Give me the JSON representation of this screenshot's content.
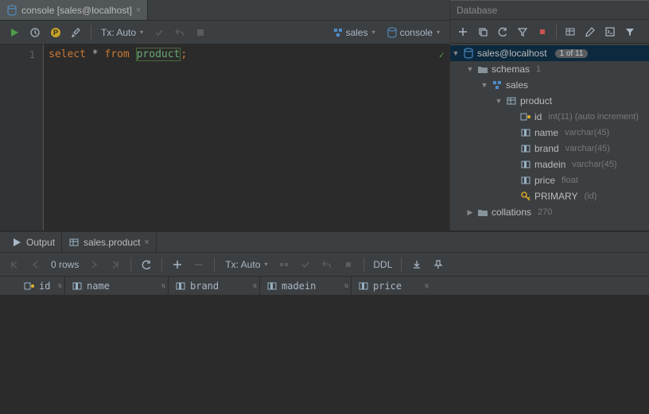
{
  "editor": {
    "tab_label": "console [sales@localhost]",
    "line_number": "1",
    "sql": {
      "k1": "select",
      "star": " * ",
      "k2": "from",
      "sp": " ",
      "tbl": "product",
      "semi": ";"
    },
    "tx_label": "Tx: Auto",
    "context_db": "sales",
    "context_console": "console"
  },
  "db": {
    "panel_title": "Database",
    "datasource": "sales@localhost",
    "badge": "1 of 11",
    "schemas_label": "schemas",
    "schemas_count": "1",
    "schema": "sales",
    "table": "product",
    "columns": [
      {
        "name": "id",
        "type": "int(11) (auto increment)",
        "pk": true
      },
      {
        "name": "name",
        "type": "varchar(45)",
        "pk": false
      },
      {
        "name": "brand",
        "type": "varchar(45)",
        "pk": false
      },
      {
        "name": "madein",
        "type": "varchar(45)",
        "pk": false
      },
      {
        "name": "price",
        "type": "float",
        "pk": false
      }
    ],
    "primary_label": "PRIMARY",
    "primary_cols": "(id)",
    "collations_label": "collations",
    "collations_count": "270"
  },
  "bottom": {
    "output_tab": "Output",
    "result_tab": "sales.product",
    "rows": "0 rows",
    "tx_label": "Tx: Auto",
    "ddl_label": "DDL",
    "headers": [
      "id",
      "name",
      "brand",
      "madein",
      "price"
    ]
  }
}
